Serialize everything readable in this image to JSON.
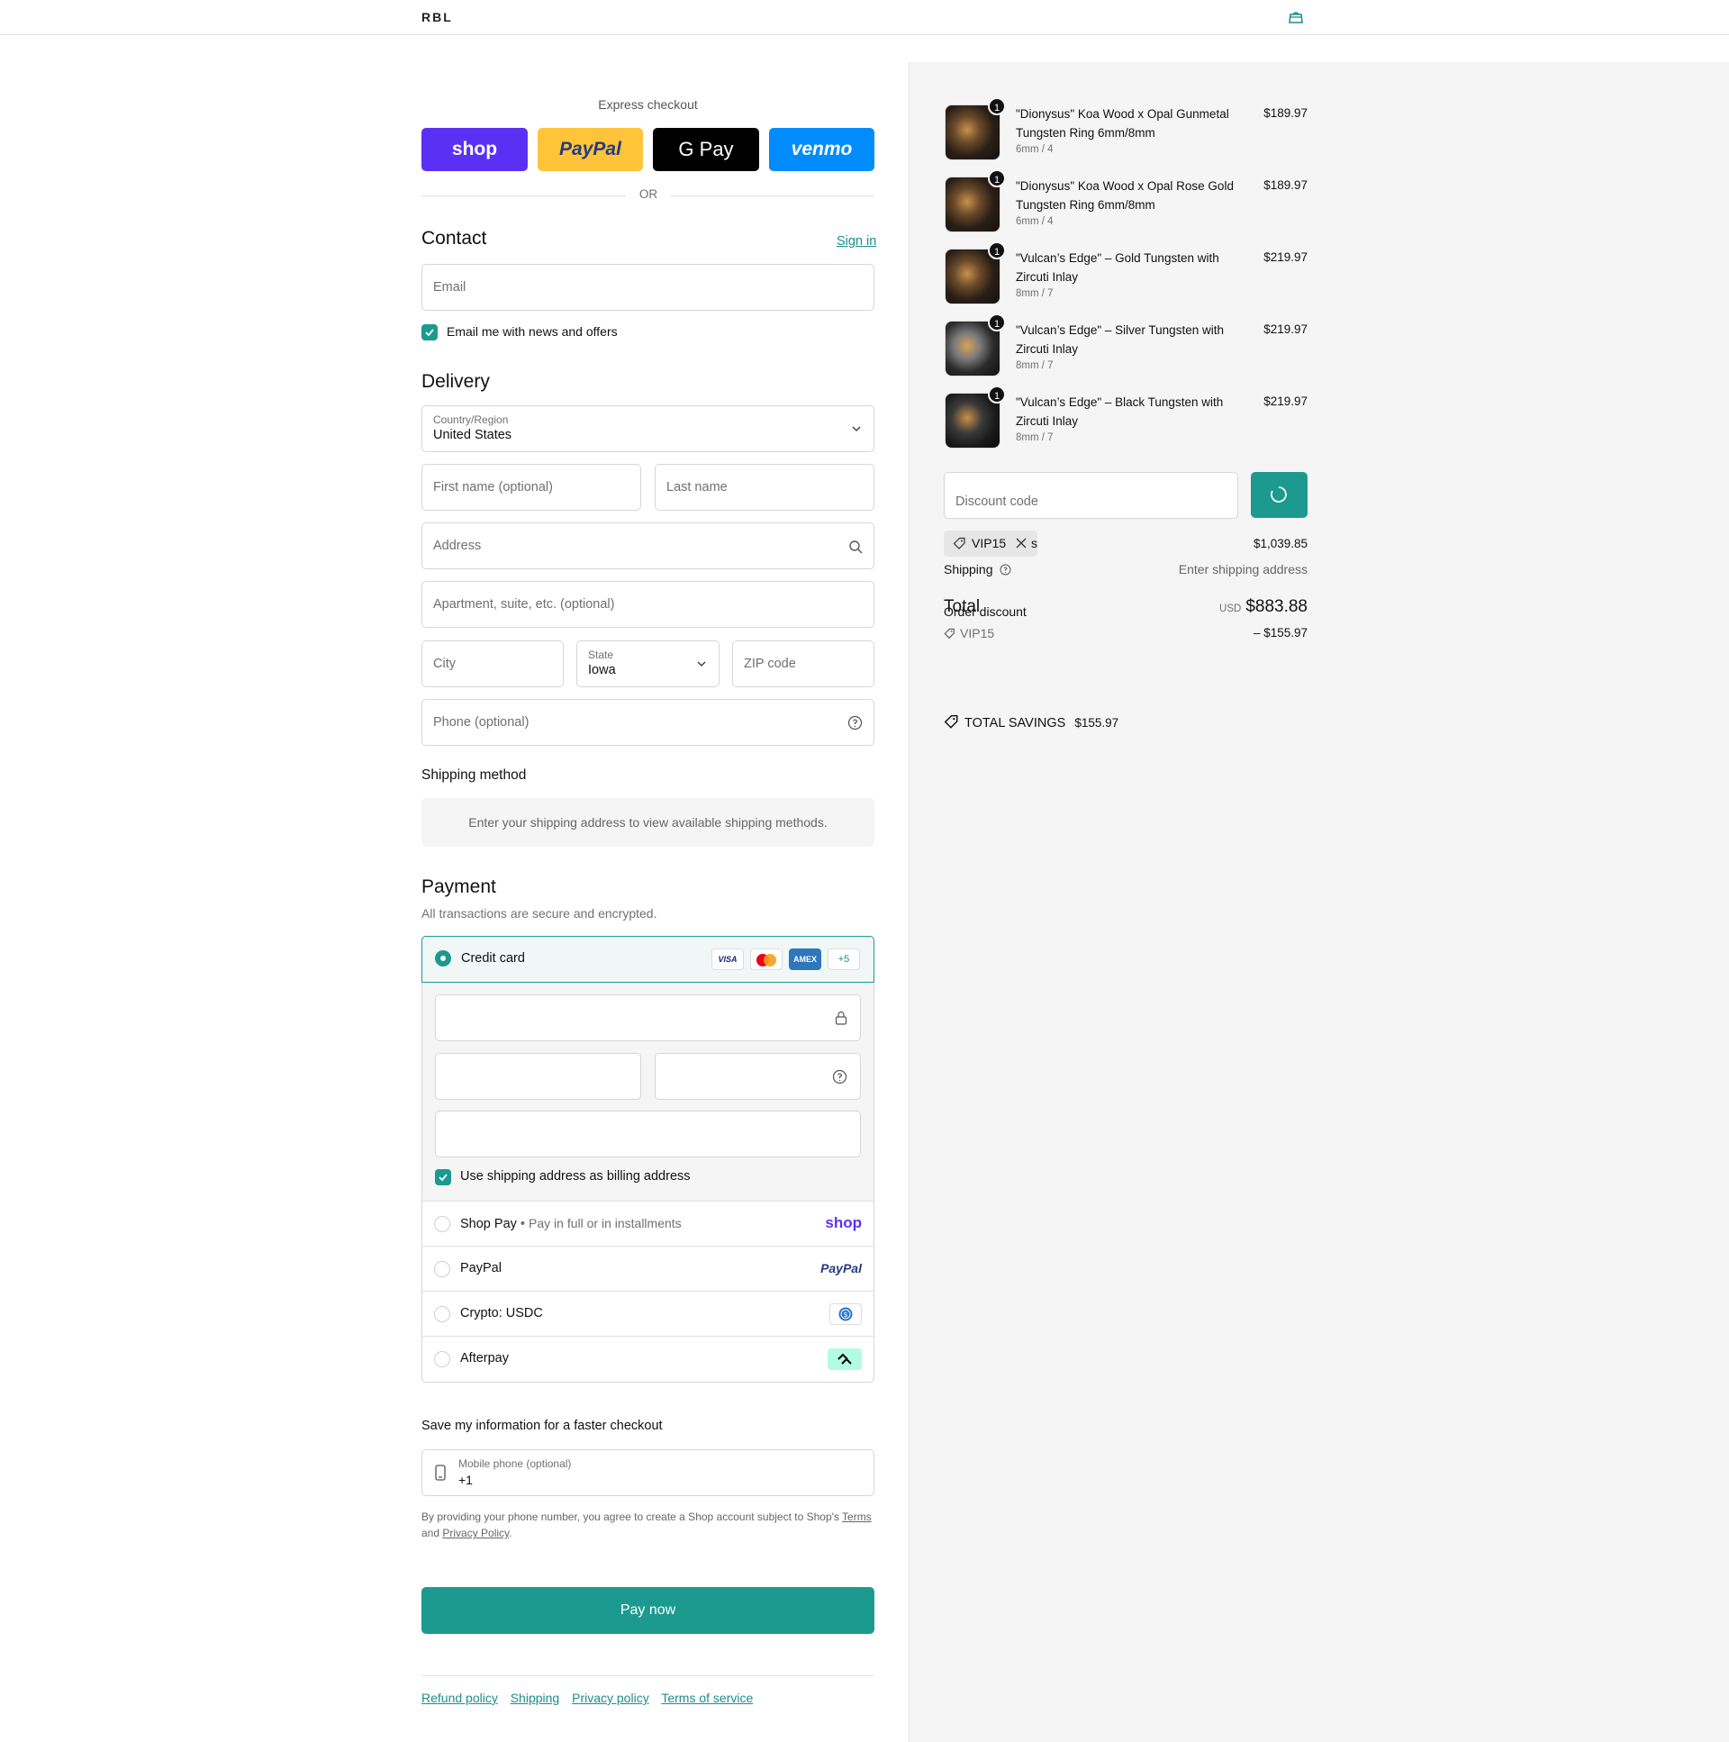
{
  "header": {
    "logo": "RBL",
    "cart_icon": "bag-icon"
  },
  "express": {
    "title": "Express checkout",
    "buttons": [
      "shop",
      "PayPal",
      "G Pay",
      "venmo"
    ],
    "divider": "OR",
    "colors": {
      "shop": "#5a31f4",
      "paypal": "#ffc439",
      "gpay": "#000000",
      "venmo": "#008cff"
    }
  },
  "contact": {
    "heading": "Contact",
    "sign_in": "Sign in",
    "email_placeholder": "Email",
    "news_label": "Email me with news and offers",
    "news_checked": true
  },
  "delivery": {
    "heading": "Delivery",
    "country_label": "Country/Region",
    "country_value": "United States",
    "first_name_placeholder": "First name (optional)",
    "last_name_placeholder": "Last name",
    "address_placeholder": "Address",
    "apartment_placeholder": "Apartment, suite, etc. (optional)",
    "city_placeholder": "City",
    "state_label": "State",
    "state_value": "Iowa",
    "zip_placeholder": "ZIP code",
    "phone_placeholder": "Phone (optional)"
  },
  "shipping_method": {
    "heading": "Shipping method",
    "notice": "Enter your shipping address to view available shipping methods."
  },
  "payment": {
    "heading": "Payment",
    "subtitle": "All transactions are secure and encrypted.",
    "credit_card_label": "Credit card",
    "card_brands": [
      "VISA",
      "mastercard",
      "AMEX"
    ],
    "more_brands": "+5",
    "billing_label": "Use shipping address as billing address",
    "billing_checked": true,
    "methods": [
      {
        "label": "Shop Pay",
        "sub": "Pay in full or in installments",
        "logo": "shop"
      },
      {
        "label": "PayPal",
        "sub": "",
        "logo": "PayPal"
      },
      {
        "label": "Crypto: USDC",
        "sub": "",
        "logo": "usdc-icon"
      },
      {
        "label": "Afterpay",
        "sub": "",
        "logo": "afterpay-icon"
      }
    ]
  },
  "save_info": {
    "heading": "Save my information for a faster checkout",
    "mobile_label": "Mobile phone (optional)",
    "mobile_value": "+1",
    "legal_prefix": "By providing your phone number, you agree to create a Shop account subject to Shop's ",
    "terms": "Terms",
    "and": "and ",
    "privacy": "Privacy Policy",
    "period": "."
  },
  "pay_now": "Pay now",
  "accent": "#1c9a8f",
  "footer_links": [
    "Refund policy",
    "Shipping",
    "Privacy policy",
    "Terms of service"
  ],
  "summary": {
    "items": [
      {
        "name": "\"Dionysus\" Koa Wood x Opal Gunmetal Tungsten Ring 6mm/8mm",
        "variant": "6mm / 4",
        "price": "$189.97",
        "qty": "1"
      },
      {
        "name": "\"Dionysus\" Koa Wood x Opal Rose Gold Tungsten Ring 6mm/8mm",
        "variant": "6mm / 4",
        "price": "$189.97",
        "qty": "1"
      },
      {
        "name": "\"Vulcan’s Edge\" – Gold Tungsten with Zircuti Inlay",
        "variant": "8mm / 7",
        "price": "$219.97",
        "qty": "1"
      },
      {
        "name": "\"Vulcan’s Edge\" – Silver Tungsten with Zircuti Inlay",
        "variant": "8mm / 7",
        "price": "$219.97",
        "qty": "1"
      },
      {
        "name": "\"Vulcan’s Edge\" – Black Tungsten with Zircuti Inlay",
        "variant": "8mm / 7",
        "price": "$219.97",
        "qty": "1"
      }
    ],
    "discount_placeholder": "Discount code",
    "applied_code": "VIP15",
    "subtotal_suffix": "s",
    "subtotal_value": "$1,039.85",
    "shipping_label": "Shipping",
    "shipping_value": "Enter shipping address",
    "total_label": "Total",
    "order_discount_label": "Order discount",
    "currency": "USD",
    "total_value": "$883.88",
    "discount_code_label": "VIP15",
    "discount_value": "– $155.97",
    "savings_label": "TOTAL SAVINGS",
    "savings_value": "$155.97"
  }
}
